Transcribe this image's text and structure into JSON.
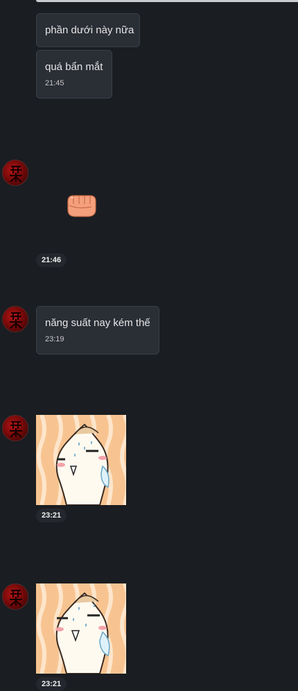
{
  "messages": {
    "m1": {
      "text": "phần dưới này nữa"
    },
    "m2": {
      "text": "quá bẩn mắt",
      "time": "21:45"
    },
    "m3": {
      "time": "21:46"
    },
    "m4": {
      "text": "năng suất nay kém thế",
      "time": "23:19"
    },
    "m5": {
      "time": "23:21"
    },
    "m6": {
      "time": "23:21"
    }
  },
  "icons": {
    "avatar": "user-avatar-red-calligraphy",
    "reaction": "fist-emoji",
    "sticker": "crying-dumpling-sticker"
  },
  "colors": {
    "background": "#1a1d21",
    "bubble": "#2a2e35",
    "bubble_border": "#3a3f47",
    "avatar_red": "#b31616",
    "sticker_bg": "#f5c08a"
  }
}
